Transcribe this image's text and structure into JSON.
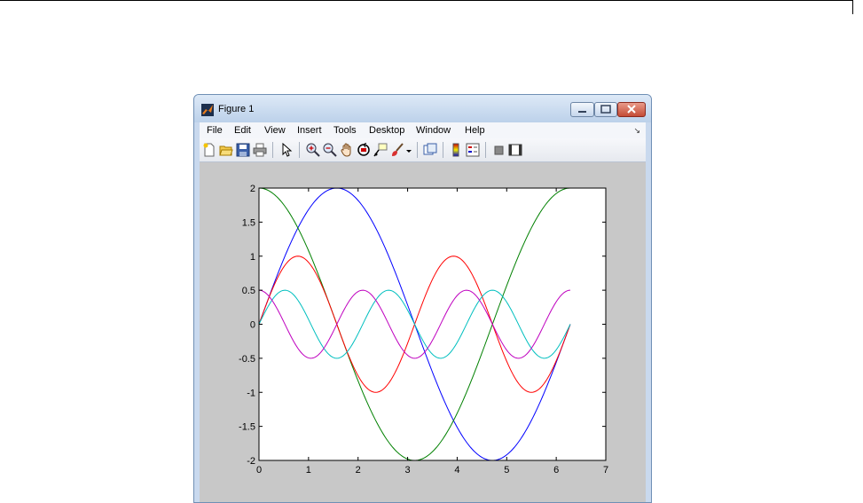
{
  "window": {
    "title": "Figure 1",
    "buttons": {
      "minimize_icon": "minimize-icon",
      "maximize_icon": "maximize-icon",
      "close_icon": "close-icon"
    }
  },
  "menu": {
    "items": [
      "File",
      "Edit",
      "View",
      "Insert",
      "Tools",
      "Desktop",
      "Window",
      "Help"
    ]
  },
  "toolbar": {
    "icons": [
      "new-figure-icon",
      "open-file-icon",
      "save-icon",
      "print-icon",
      "pointer-icon",
      "zoom-in-icon",
      "zoom-out-icon",
      "pan-icon",
      "rotate-3d-icon",
      "data-cursor-icon",
      "brush-icon",
      "link-plot-icon",
      "colorbar-icon",
      "legend-icon",
      "hide-plot-tools-icon",
      "show-plot-tools-icon"
    ]
  },
  "colors": {
    "blue": "#0000ff",
    "green": "#008000",
    "red": "#ff0000",
    "cyan": "#00bfbf",
    "magenta": "#bf00bf"
  },
  "chart_data": {
    "type": "line",
    "title": "",
    "xlabel": "",
    "ylabel": "",
    "xlim": [
      0,
      7
    ],
    "ylim": [
      -2,
      2
    ],
    "xticks": [
      0,
      1,
      2,
      3,
      4,
      5,
      6,
      7
    ],
    "yticks": [
      2,
      1.5,
      1,
      0.5,
      0,
      -0.5,
      -1,
      -1.5,
      -2
    ],
    "x_range": [
      0,
      6.2832
    ],
    "series": [
      {
        "color": "#0000ff",
        "formula": "2*sin(x)"
      },
      {
        "color": "#008000",
        "formula": "2*cos(x)"
      },
      {
        "color": "#ff0000",
        "formula": "sin(2*x)"
      },
      {
        "color": "#00bfbf",
        "formula": "0.5*sin(3*x)"
      },
      {
        "color": "#bf00bf",
        "formula": "0.5*cos(3*x)"
      }
    ],
    "grid": false
  }
}
